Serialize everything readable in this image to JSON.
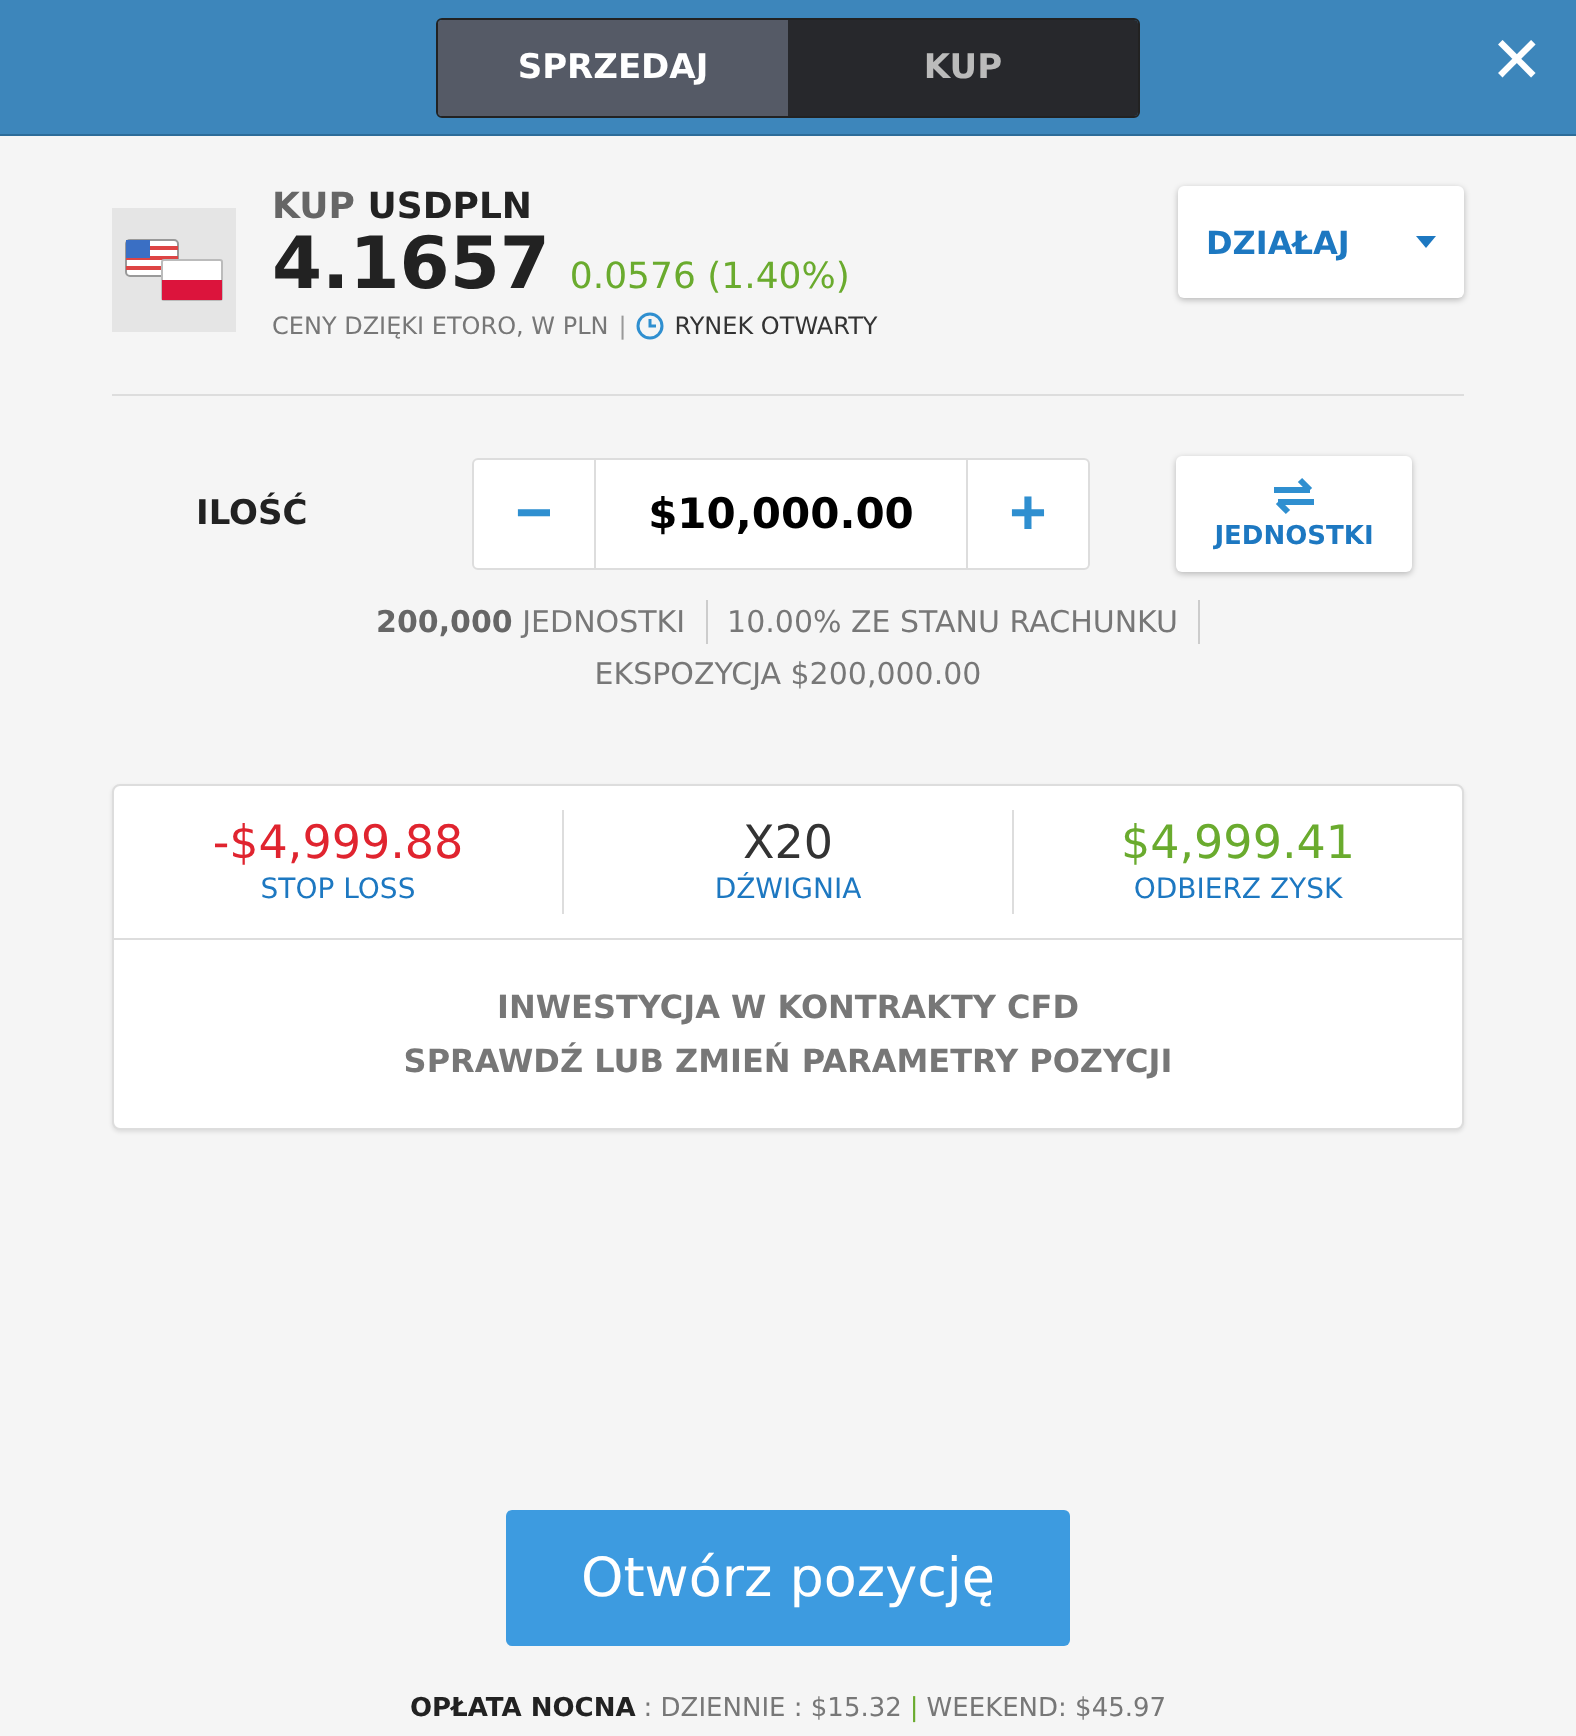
{
  "tabs": [
    {
      "label": "SPRZEDAJ",
      "selected": false
    },
    {
      "label": "KUP",
      "selected": true
    }
  ],
  "close": "✕",
  "instrument": {
    "action": "KUP",
    "symbol": "USDPLN",
    "price": "4.1657",
    "change": "0.0576 (1.40%)",
    "source": "CENY DZIĘKI ETORO, W PLN",
    "separator": "|",
    "market": "RYNEK OTWARTY"
  },
  "action_menu": {
    "label": "DZIAŁAJ"
  },
  "amount": {
    "label": "ILOŚĆ",
    "minus": "−",
    "value": "$10,000.00",
    "plus": "+",
    "unit_toggle": "JEDNOSTKI"
  },
  "details": {
    "units": "**200,000** JEDNOSTKI",
    "share": "10.00% ZE STANU RACHUNKU",
    "exposure": "EKSPOZYCJA $200,000.00"
  },
  "params": [
    {
      "kind": "loss",
      "value": "-$4,999.88",
      "label": "STOP LOSS"
    },
    {
      "kind": "neutral",
      "value": "X20",
      "label": "DŹWIGNIA"
    },
    {
      "kind": "profit",
      "value": "$4,999.41",
      "label": "ODBIERZ ZYSK"
    }
  ],
  "notice": [
    "INWESTYCJA W KONTRAKTY CFD",
    "SPRAWDŹ LUB ZMIEŃ PARAMETRY POZYCJI"
  ],
  "open_button": "Otwórz pozycję",
  "fee": {
    "label": "OPŁATA NOCNA",
    "daily": ": DZIENNIE : $15.32",
    "separator": "|",
    "weekend": "WEEKEND: $45.97"
  }
}
